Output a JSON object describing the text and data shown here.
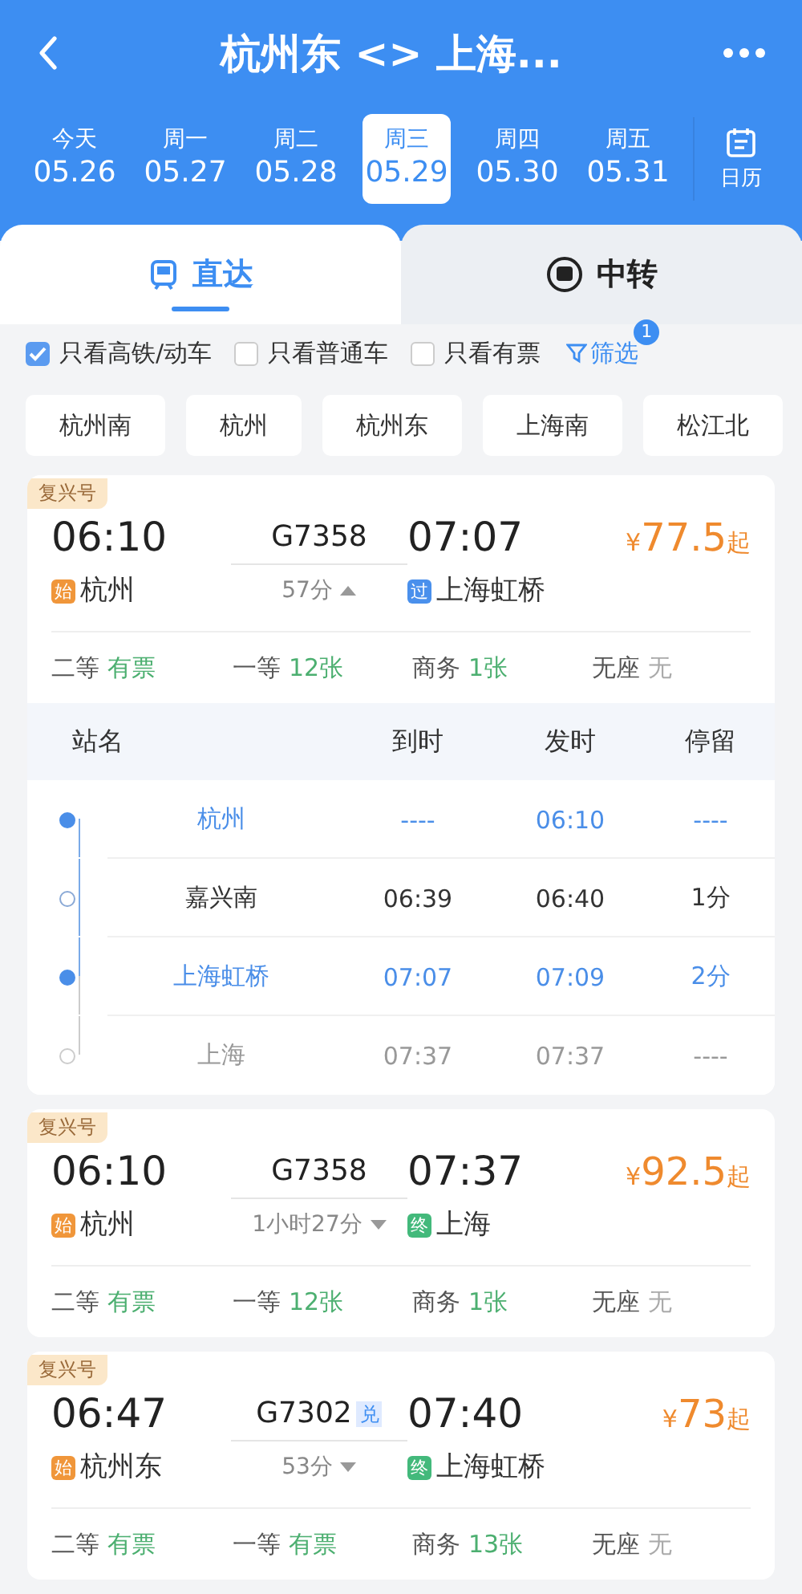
{
  "header": {
    "title": "杭州东 <> 上海..."
  },
  "dates": [
    {
      "weekday": "今天",
      "date": "05.26",
      "selected": false
    },
    {
      "weekday": "周一",
      "date": "05.27",
      "selected": false
    },
    {
      "weekday": "周二",
      "date": "05.28",
      "selected": false
    },
    {
      "weekday": "周三",
      "date": "05.29",
      "selected": true
    },
    {
      "weekday": "周四",
      "date": "05.30",
      "selected": false
    },
    {
      "weekday": "周五",
      "date": "05.31",
      "selected": false
    }
  ],
  "calendar": {
    "label": "日历"
  },
  "tabs": [
    {
      "kind": "direct",
      "label": "直达",
      "selected": true
    },
    {
      "kind": "transfer",
      "label": "中转",
      "selected": false
    }
  ],
  "filters": [
    {
      "label": "只看高铁/动车",
      "checked": true
    },
    {
      "label": "只看普通车",
      "checked": false
    },
    {
      "label": "只看有票",
      "checked": false
    }
  ],
  "filter_button": {
    "label": "筛选",
    "badge": "1"
  },
  "stations": [
    "杭州南",
    "杭州",
    "杭州东",
    "上海南",
    "松江北"
  ],
  "trains": [
    {
      "badge": "复兴号",
      "depart_time": "06:10",
      "number": "G7358",
      "duration": "57分",
      "expanded": true,
      "arrive_time": "07:07",
      "currency": "¥",
      "price": "77.5",
      "price_suffix": "起",
      "from": {
        "kind": "start",
        "tag": "始",
        "name": "杭州"
      },
      "to": {
        "kind": "pass",
        "tag": "过",
        "name": "上海虹桥"
      },
      "seats": [
        {
          "class": "二等",
          "availability": "有票",
          "available": true
        },
        {
          "class": "一等",
          "availability": "12张",
          "available": true
        },
        {
          "class": "商务",
          "availability": "1张",
          "available": true
        },
        {
          "class": "无座",
          "availability": "无",
          "available": false
        }
      ],
      "stop_columns": [
        "站名",
        "到时",
        "发时",
        "停留"
      ],
      "stops": [
        {
          "kind": "board",
          "name": "杭州",
          "arrive": "----",
          "depart": "06:10",
          "stay": "----"
        },
        {
          "kind": "via",
          "name": "嘉兴南",
          "arrive": "06:39",
          "depart": "06:40",
          "stay": "1分"
        },
        {
          "kind": "board",
          "name": "上海虹桥",
          "arrive": "07:07",
          "depart": "07:09",
          "stay": "2分"
        },
        {
          "kind": "beyond",
          "name": "上海",
          "arrive": "07:37",
          "depart": "07:37",
          "stay": "----"
        }
      ]
    },
    {
      "badge": "复兴号",
      "depart_time": "06:10",
      "number": "G7358",
      "duration": "1小时27分",
      "expanded": false,
      "arrive_time": "07:37",
      "currency": "¥",
      "price": "92.5",
      "price_suffix": "起",
      "from": {
        "kind": "start",
        "tag": "始",
        "name": "杭州"
      },
      "to": {
        "kind": "end",
        "tag": "终",
        "name": "上海"
      },
      "seats": [
        {
          "class": "二等",
          "availability": "有票",
          "available": true
        },
        {
          "class": "一等",
          "availability": "12张",
          "available": true
        },
        {
          "class": "商务",
          "availability": "1张",
          "available": true
        },
        {
          "class": "无座",
          "availability": "无",
          "available": false
        }
      ]
    },
    {
      "badge": "复兴号",
      "depart_time": "06:47",
      "number": "G7302",
      "ticket_tag": "兑",
      "duration": "53分",
      "expanded": false,
      "arrive_time": "07:40",
      "currency": "¥",
      "price": "73",
      "price_suffix": "起",
      "from": {
        "kind": "start",
        "tag": "始",
        "name": "杭州东"
      },
      "to": {
        "kind": "end",
        "tag": "终",
        "name": "上海虹桥"
      },
      "seats": [
        {
          "class": "二等",
          "availability": "有票",
          "available": true
        },
        {
          "class": "一等",
          "availability": "有票",
          "available": true
        },
        {
          "class": "商务",
          "availability": "13张",
          "available": true
        },
        {
          "class": "无座",
          "availability": "无",
          "available": false
        }
      ]
    }
  ]
}
